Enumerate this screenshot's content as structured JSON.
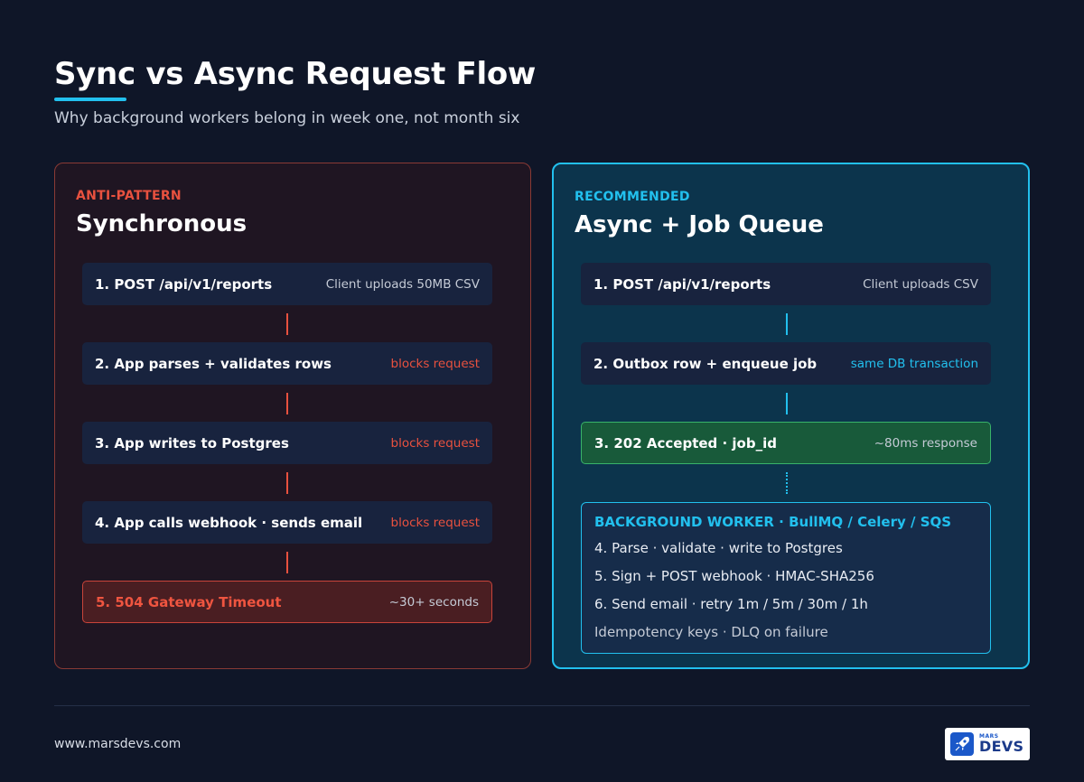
{
  "header": {
    "title": "Sync vs Async Request Flow",
    "subtitle": "Why background workers belong in week one, not month six"
  },
  "colors": {
    "background": "#0f1628",
    "accent_cyan": "#22c0ee",
    "danger_red": "#e8513f",
    "success_green": "#185a3a"
  },
  "sync": {
    "kicker": "ANTI-PATTERN",
    "title": "Synchronous",
    "steps": [
      {
        "label": "1. POST /api/v1/reports",
        "note": "Client uploads 50MB CSV"
      },
      {
        "label": "2. App parses + validates rows",
        "note": "blocks request"
      },
      {
        "label": "3. App writes to Postgres",
        "note": "blocks request"
      },
      {
        "label": "4. App calls webhook · sends email",
        "note": "blocks request"
      },
      {
        "label": "5. 504 Gateway Timeout",
        "note": "~30+ seconds"
      }
    ]
  },
  "async": {
    "kicker": "RECOMMENDED",
    "title": "Async + Job Queue",
    "steps": [
      {
        "label": "1. POST /api/v1/reports",
        "note": "Client uploads CSV"
      },
      {
        "label": "2. Outbox row + enqueue job",
        "note": "same DB transaction"
      },
      {
        "label": "3. 202 Accepted · job_id",
        "note": "~80ms response"
      }
    ],
    "worker": {
      "title": "BACKGROUND WORKER · BullMQ / Celery / SQS",
      "lines": [
        "4. Parse · validate · write to Postgres",
        "5. Sign + POST webhook · HMAC-SHA256",
        "6. Send email · retry 1m / 5m / 30m / 1h",
        "Idempotency keys · DLQ on failure"
      ]
    }
  },
  "footer": {
    "url": "www.marsdevs.com",
    "logo_small": "MARS",
    "logo_big": "DEVS",
    "logo_icon": "rocket-icon"
  }
}
